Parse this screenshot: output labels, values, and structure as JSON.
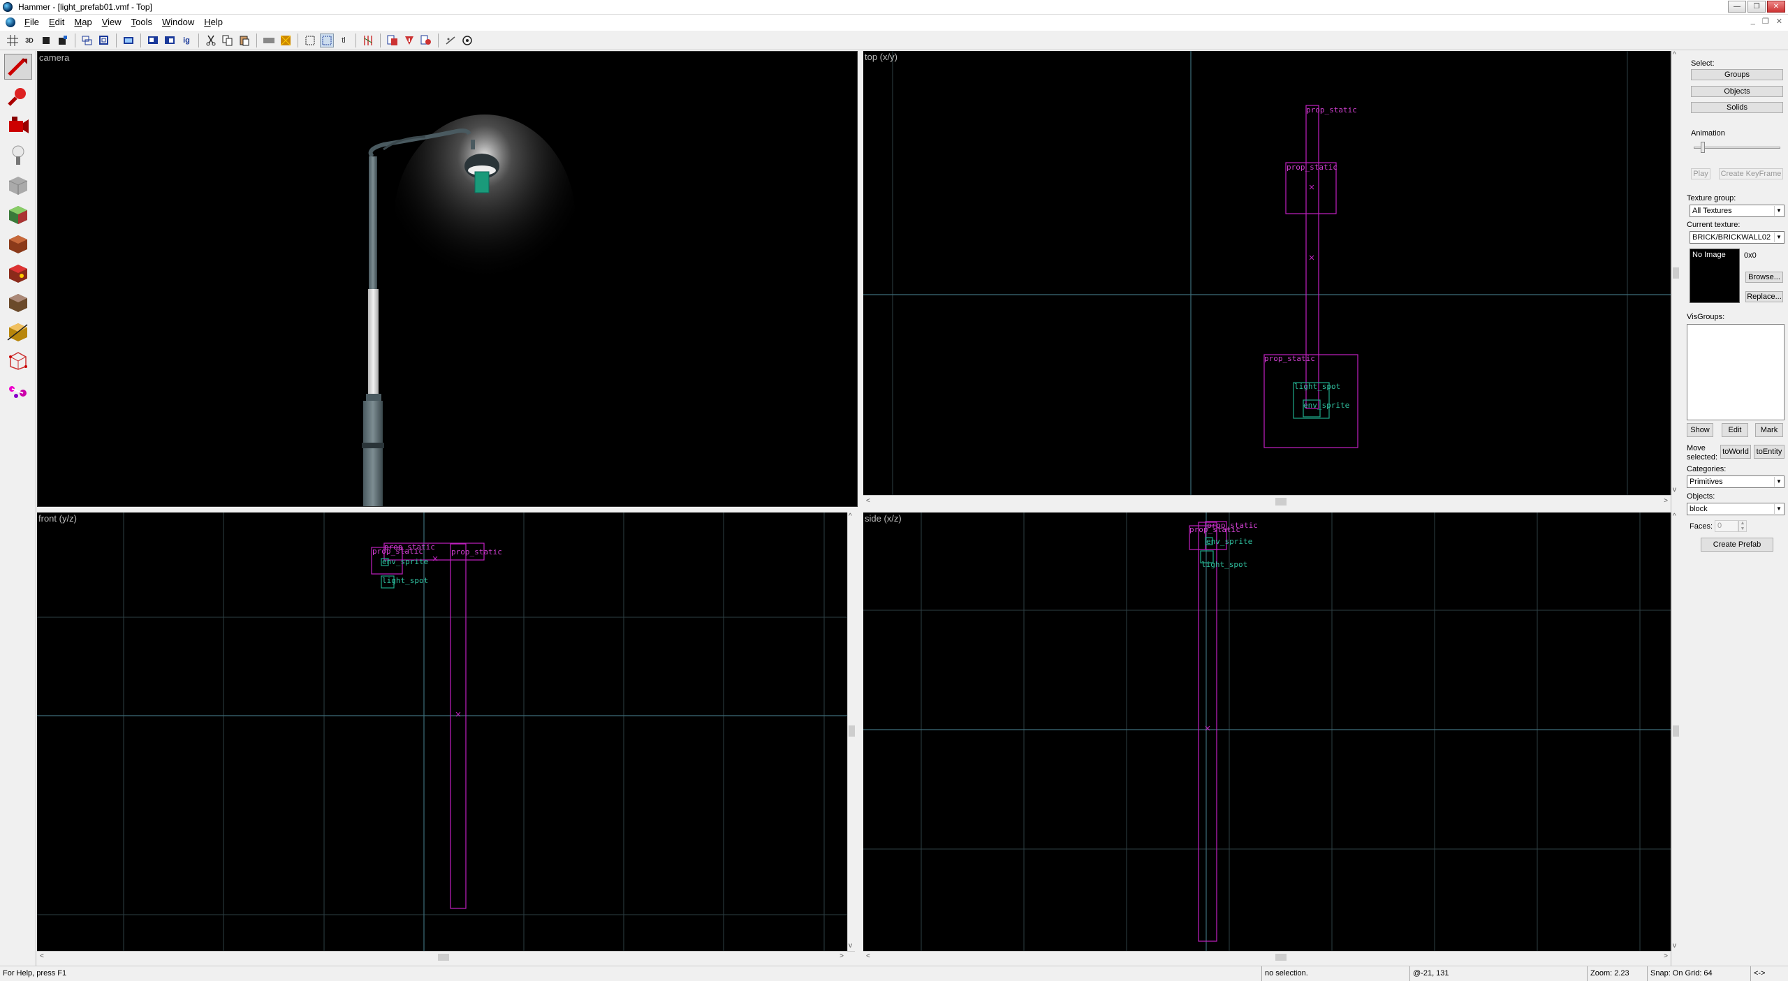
{
  "window": {
    "title": "Hammer - [light_prefab01.vmf - Top]"
  },
  "menu": [
    "File",
    "Edit",
    "Map",
    "View",
    "Tools",
    "Window",
    "Help"
  ],
  "viewports": {
    "camera": {
      "label": "camera"
    },
    "top": {
      "label": "top (x/y)"
    },
    "front": {
      "label": "front (y/z)"
    },
    "side": {
      "label": "side (x/z)"
    }
  },
  "entity_labels": {
    "prop_static": "prop_static",
    "light_spot": "light_spot",
    "env_sprite": "env_sprite"
  },
  "panel": {
    "select_label": "Select:",
    "groups_button": "Groups",
    "objects_button": "Objects",
    "solids_button": "Solids",
    "animation_label": "Animation",
    "play_button": "Play",
    "create_keyframe_button": "Create KeyFrame",
    "texture_group_label": "Texture group:",
    "texture_group_value": "All Textures",
    "current_texture_label": "Current texture:",
    "current_texture_value": "BRICK/BRICKWALL02",
    "no_image_text": "No Image",
    "texture_size": "0x0",
    "browse_button": "Browse...",
    "replace_button": "Replace...",
    "visgroups_label": "VisGroups:",
    "show_button": "Show",
    "edit_button": "Edit",
    "mark_button": "Mark",
    "move_selected_label_1": "Move",
    "move_selected_label_2": "selected:",
    "to_world_button": "toWorld",
    "to_entity_button": "toEntity",
    "categories_label": "Categories:",
    "categories_value": "Primitives",
    "objects_label": "Objects:",
    "objects_value": "block",
    "faces_label": "Faces:",
    "faces_value": "0",
    "create_prefab_button": "Create Prefab"
  },
  "status": {
    "help": "For Help, press F1",
    "selection": "no selection.",
    "coords": "@-21, 131",
    "zoom": "Zoom: 2.23",
    "snap": "Snap: On Grid: 64",
    "extra": "<->"
  }
}
